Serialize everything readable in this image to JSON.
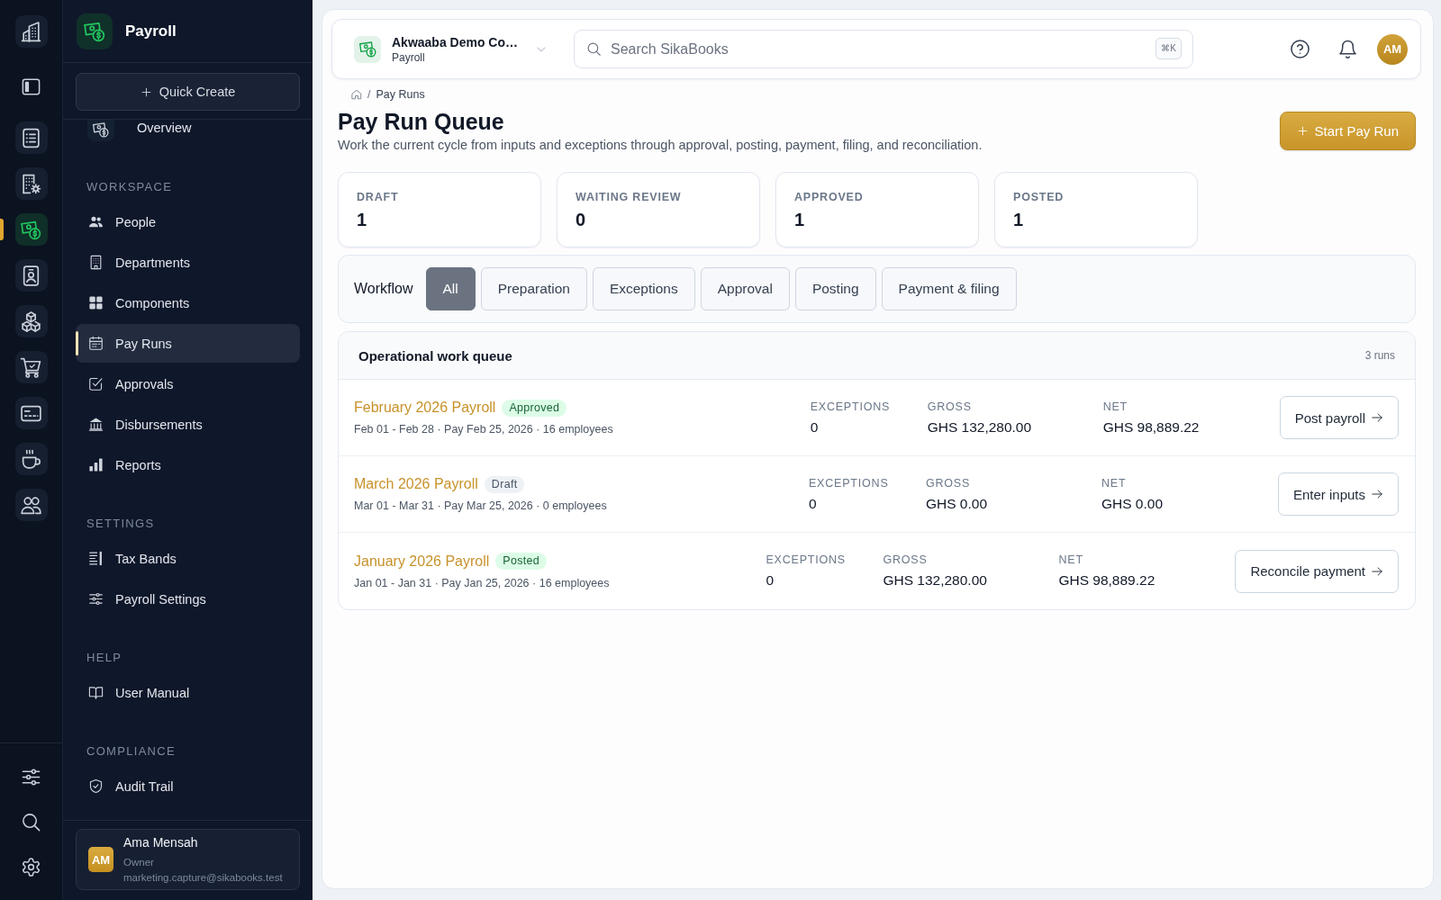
{
  "rail": {
    "apps": [
      {
        "selected": false
      },
      {
        "selected": false
      },
      {
        "selected": false
      },
      {
        "selected": true
      },
      {
        "selected": false
      },
      {
        "selected": false
      },
      {
        "selected": false
      },
      {
        "selected": false
      },
      {
        "selected": false
      },
      {
        "selected": false
      }
    ]
  },
  "sidebar": {
    "title": "Payroll",
    "quick_create": "Quick Create",
    "overview": {
      "label": "Overview",
      "selected": false
    },
    "sections": [
      {
        "title": "WORKSPACE",
        "items": [
          {
            "label": "People",
            "selected": false
          },
          {
            "label": "Departments",
            "selected": false
          },
          {
            "label": "Components",
            "selected": false
          },
          {
            "label": "Pay Runs",
            "selected": true
          },
          {
            "label": "Approvals",
            "selected": false
          },
          {
            "label": "Disbursements",
            "selected": false
          },
          {
            "label": "Reports",
            "selected": false
          }
        ]
      },
      {
        "title": "SETTINGS",
        "items": [
          {
            "label": "Tax Bands",
            "selected": false
          },
          {
            "label": "Payroll Settings",
            "selected": false
          }
        ]
      },
      {
        "title": "HELP",
        "items": [
          {
            "label": "User Manual",
            "selected": false
          }
        ]
      },
      {
        "title": "COMPLIANCE",
        "items": [
          {
            "label": "Audit Trail",
            "selected": false
          }
        ]
      }
    ],
    "user": {
      "initials": "AM",
      "name": "Ama Mensah",
      "role": "Owner",
      "email": "marketing.capture@sikabooks.test"
    }
  },
  "topbar": {
    "company": "Akwaaba Demo Co…",
    "module": "Payroll",
    "search": {
      "placeholder": "Search SikaBooks",
      "shortcut": "⌘K"
    },
    "avatar": "AM"
  },
  "breadcrumb": {
    "separator": "/",
    "current": "Pay Runs"
  },
  "page": {
    "title": "Pay Run Queue",
    "description": "Work the current cycle from inputs and exceptions through approval, posting, payment, filing, and reconciliation.",
    "primary_action": "Start Pay Run"
  },
  "stats": [
    {
      "label": "DRAFT",
      "value": "1"
    },
    {
      "label": "WAITING REVIEW",
      "value": "0"
    },
    {
      "label": "APPROVED",
      "value": "1"
    },
    {
      "label": "POSTED",
      "value": "1"
    }
  ],
  "workflow": {
    "label": "Workflow",
    "tabs": [
      {
        "label": "All",
        "selected": true
      },
      {
        "label": "Preparation",
        "selected": false
      },
      {
        "label": "Exceptions",
        "selected": false
      },
      {
        "label": "Approval",
        "selected": false
      },
      {
        "label": "Posting",
        "selected": false
      },
      {
        "label": "Payment & filing",
        "selected": false
      }
    ]
  },
  "queue": {
    "title": "Operational work queue",
    "count": "3 runs",
    "rows": [
      {
        "title": "February 2026 Payroll",
        "status": {
          "text": "Approved",
          "kind": "success"
        },
        "meta": "Feb 01 - Feb 28 · Pay Feb 25, 2026 · 16 employees",
        "metrics": [
          {
            "label": "EXCEPTIONS",
            "value": "0"
          },
          {
            "label": "GROSS",
            "value": "GHS 132,280.00"
          },
          {
            "label": "NET",
            "value": "GHS 98,889.22"
          }
        ],
        "action": "Post payroll"
      },
      {
        "title": "March 2026 Payroll",
        "status": {
          "text": "Draft",
          "kind": "neutral"
        },
        "meta": "Mar 01 - Mar 31 · Pay Mar 25, 2026 · 0 employees",
        "metrics": [
          {
            "label": "EXCEPTIONS",
            "value": "0"
          },
          {
            "label": "GROSS",
            "value": "GHS 0.00"
          },
          {
            "label": "NET",
            "value": "GHS 0.00"
          }
        ],
        "action": "Enter inputs"
      },
      {
        "title": "January 2026 Payroll",
        "status": {
          "text": "Posted",
          "kind": "success"
        },
        "meta": "Jan 01 - Jan 31 · Pay Jan 25, 2026 · 16 employees",
        "metrics": [
          {
            "label": "EXCEPTIONS",
            "value": "0"
          },
          {
            "label": "GROSS",
            "value": "GHS 132,280.00"
          },
          {
            "label": "NET",
            "value": "GHS 98,889.22"
          }
        ],
        "action": "Reconcile payment"
      }
    ]
  }
}
